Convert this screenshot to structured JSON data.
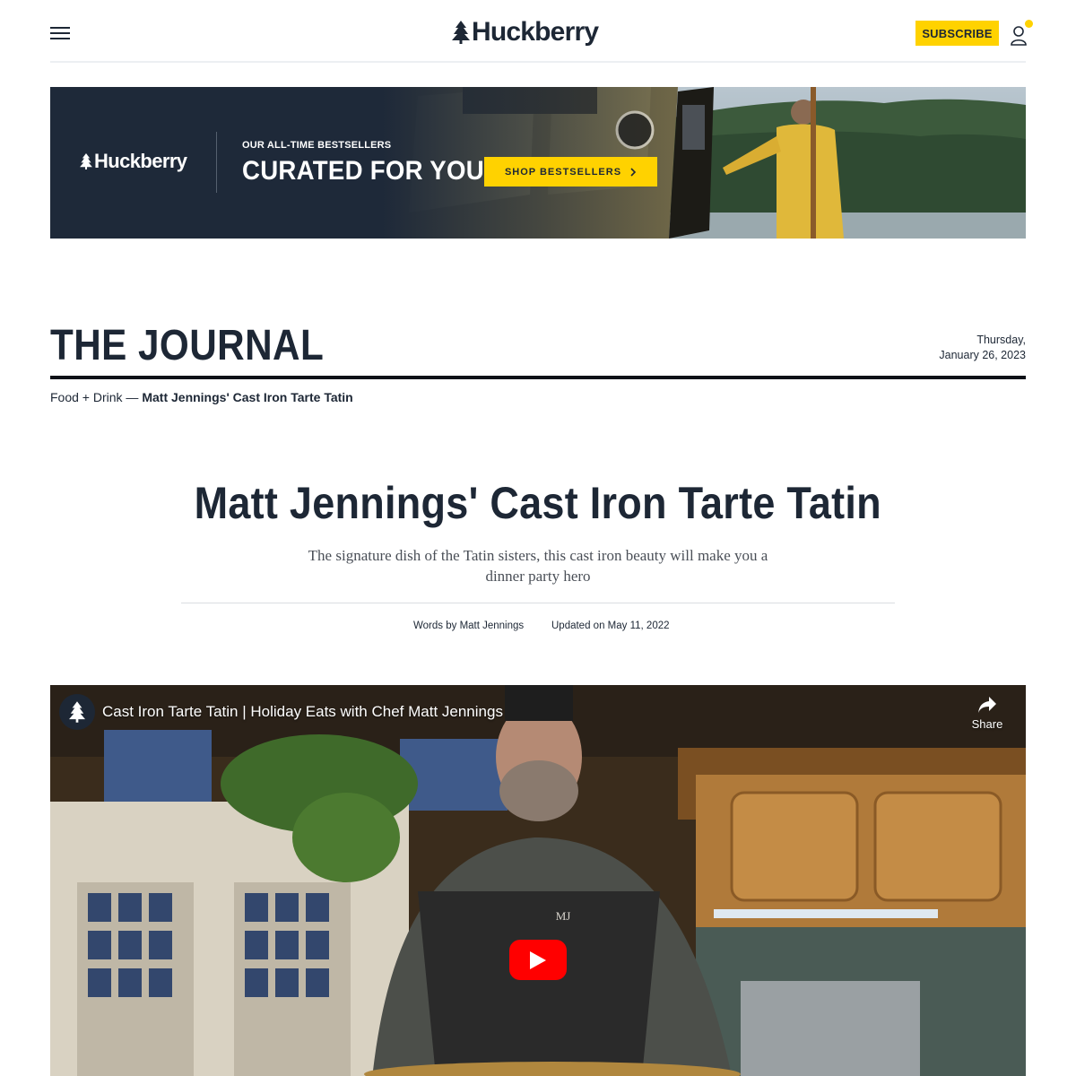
{
  "header": {
    "brand": "Huckberry",
    "subscribe_label": "SUBSCRIBE",
    "menu_icon": "hamburger-icon",
    "account_icon": "user-icon",
    "accent_color": "#ffd200"
  },
  "banner": {
    "brand": "Huckberry",
    "eyebrow": "OUR ALL-TIME BESTSELLERS",
    "headline": "CURATED FOR YOU",
    "cta_label": "SHOP BESTSELLERS",
    "cta_icon": "chevron-right-icon",
    "background_color": "#1e2939"
  },
  "journal": {
    "title": "THE JOURNAL",
    "date_line1": "Thursday,",
    "date_line2": "January 26, 2023"
  },
  "breadcrumb": {
    "category": "Food + Drink",
    "separator": " — ",
    "current": "Matt Jennings' Cast Iron Tarte Tatin"
  },
  "article": {
    "title": "Matt Jennings' Cast Iron Tarte Tatin",
    "dek": "The signature dish of the Tatin sisters, this cast iron beauty will make you a dinner party hero",
    "byline_prefix": "Words by ",
    "author": "Matt Jennings",
    "updated_prefix": "Updated on ",
    "updated_date": "May 11, 2022"
  },
  "video": {
    "title": "Cast Iron Tarte Tatin | Holiday Eats with Chef Matt Jennings",
    "share_label": "Share",
    "share_icon": "share-arrow-icon",
    "play_icon": "play-icon",
    "apron_monogram": "MJ"
  }
}
